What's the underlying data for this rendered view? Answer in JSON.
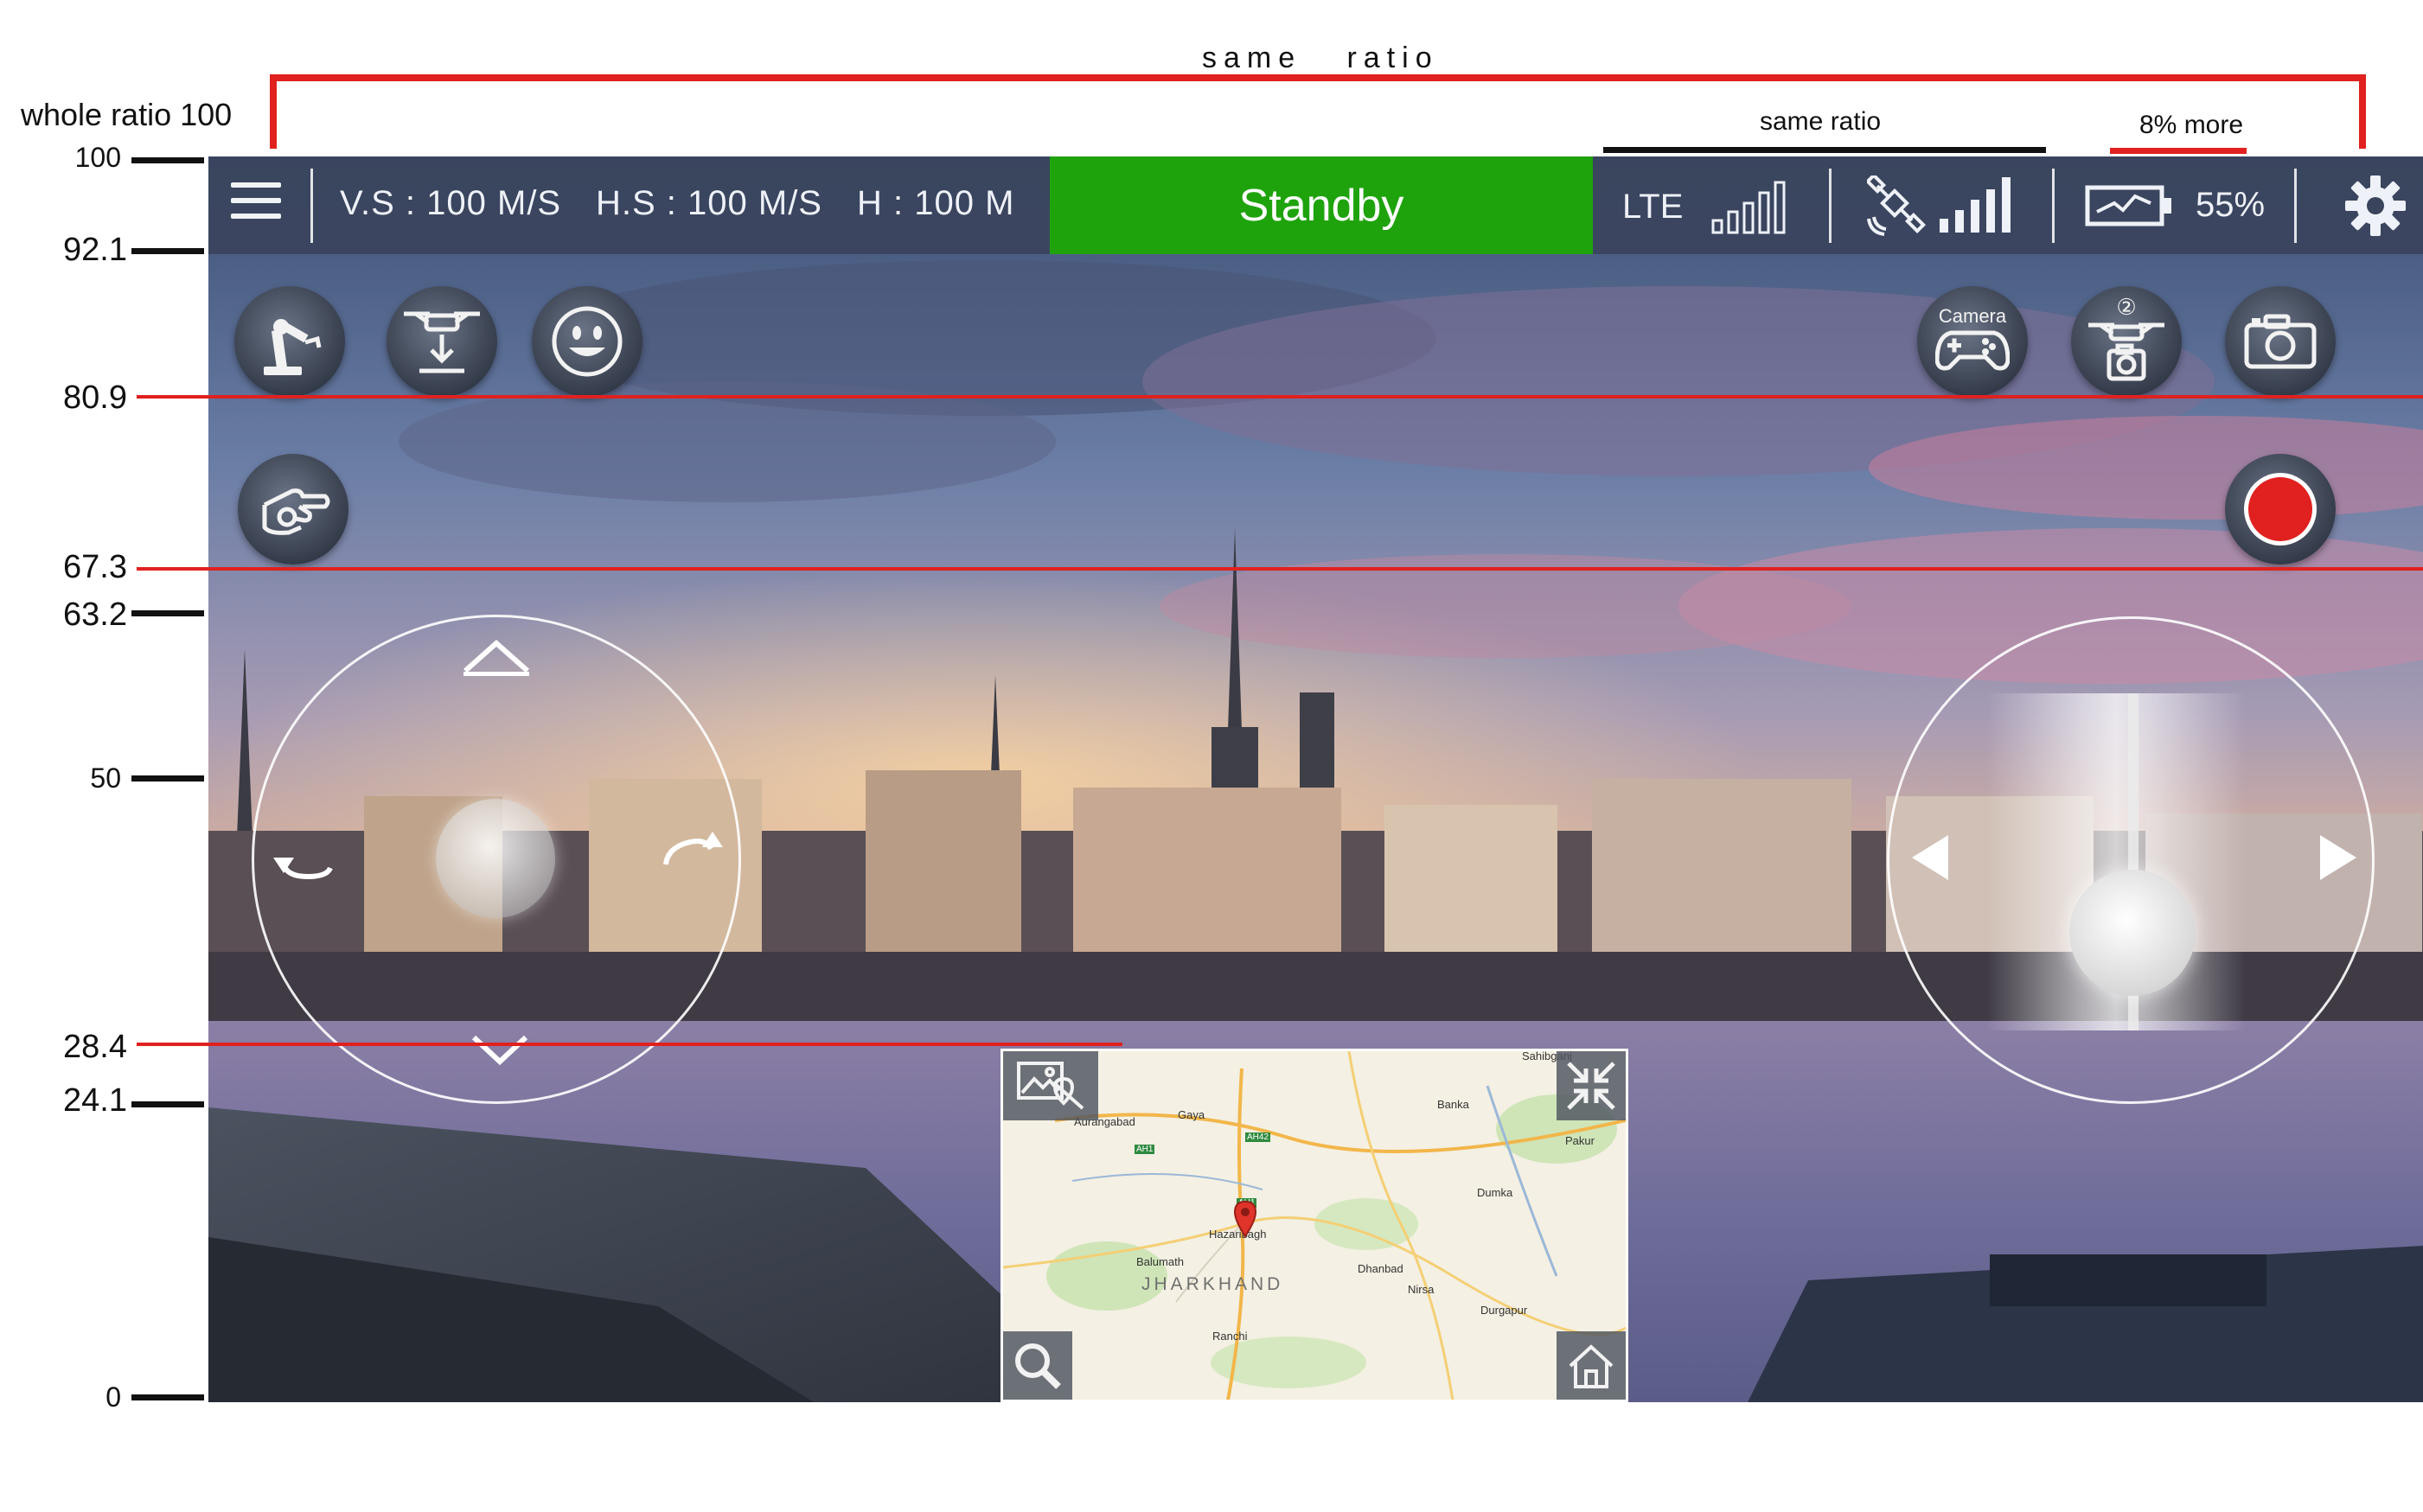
{
  "annotations": {
    "top_bracket_label": "same   ratio",
    "whole_ratio_label": "whole ratio 100",
    "same_ratio_label": "same ratio",
    "more_label": "8% more",
    "ruler_marks": [
      "100",
      "92.1",
      "80.9",
      "67.3",
      "63.2",
      "50",
      "28.4",
      "24.1",
      "0"
    ]
  },
  "topbar": {
    "vs_label": "V.S : 100 M/S",
    "hs_label": "H.S : 100 M/S",
    "h_label": "H : 100 M",
    "status": "Standby",
    "network_label": "LTE",
    "battery_percent": "55%",
    "network_signal_bars_lit": 0,
    "gps_signal_bars_lit": 5
  },
  "left_buttons": [
    "robot-arm-icon",
    "drone-land-icon",
    "smiley-icon",
    "gesture-hand-icon"
  ],
  "right_buttons": {
    "camera_controller_label": "Camera",
    "drone_camera_badge": "②",
    "icons": [
      "gamepad-icon",
      "drone-camera-icon",
      "camera-icon",
      "record-icon"
    ]
  },
  "map": {
    "places": [
      "Aurangabad",
      "Gaya",
      "Banka",
      "Pakur",
      "Dumka",
      "Hazaribagh",
      "Balumath",
      "Dhanbad",
      "Nirsa",
      "Durgapur",
      "Ranchi"
    ],
    "road_labels": [
      "AH1",
      "AH42",
      "AH1"
    ],
    "region": "JHARKHAND",
    "top_right_place": "Sahibganj"
  },
  "colors": {
    "topbar": "#3a445c",
    "standby": "#1fa30d",
    "record": "#e0211f",
    "annotation_red": "#e0211f"
  }
}
